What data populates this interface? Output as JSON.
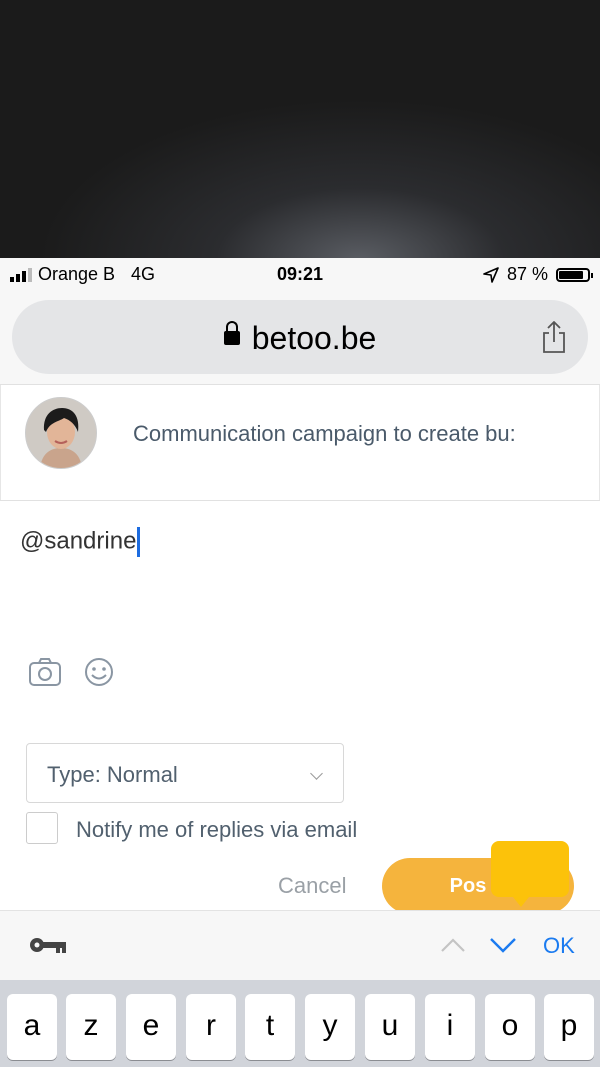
{
  "status_bar": {
    "carrier": "Orange B",
    "network": "4G",
    "time": "09:21",
    "battery": "87 %",
    "battery_level": 0.87
  },
  "browser": {
    "url": "betoo.be",
    "icons": [
      "lock-icon",
      "share-icon"
    ]
  },
  "post_card": {
    "title": "Communication campaign to create bu:"
  },
  "comment": {
    "text": "@sandrine"
  },
  "attachments": {
    "icons": [
      "camera-icon",
      "emoji-icon"
    ]
  },
  "type_select": {
    "value": "Type: Normal"
  },
  "notify": {
    "label": "Notify me of replies via email",
    "checked": false
  },
  "actions": {
    "cancel": "Cancel",
    "post": "Pos"
  },
  "keyboard_toolbar": {
    "ok": "OK",
    "icons": [
      "key-icon",
      "chevron-up-icon",
      "chevron-down-icon"
    ]
  },
  "keyboard": {
    "row1": [
      "a",
      "z",
      "e",
      "r",
      "t",
      "y",
      "u",
      "i",
      "o",
      "p"
    ]
  },
  "colors": {
    "accent_orange": "#f5b43d",
    "tooltip_yellow": "#fcc20a",
    "link_blue": "#1b7bf0",
    "caret_blue": "#1d6ce0"
  }
}
